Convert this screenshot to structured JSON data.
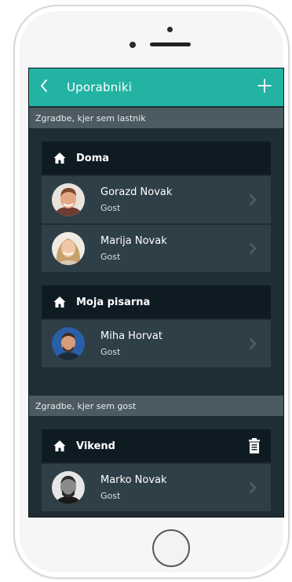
{
  "header": {
    "title": "Uporabniki",
    "back_icon": "chevron-left-icon",
    "add_icon": "plus-icon",
    "accent_color": "#23b3a3"
  },
  "sections": [
    {
      "title": "Zgradbe, kjer sem lastnik",
      "buildings": [
        {
          "name": "Doma",
          "users": [
            {
              "name": "Gorazd Novak",
              "role": "Gost"
            },
            {
              "name": "Marija Novak",
              "role": "Gost"
            }
          ]
        },
        {
          "name": "Moja pisarna",
          "users": [
            {
              "name": "Miha Horvat",
              "role": "Gost"
            }
          ]
        }
      ]
    },
    {
      "title": "Zgradbe, kjer sem gost",
      "buildings": [
        {
          "name": "Vikend",
          "trash_icon": "trash-icon",
          "users": [
            {
              "name": "Marko Novak",
              "role": "Gost"
            }
          ]
        }
      ]
    }
  ]
}
